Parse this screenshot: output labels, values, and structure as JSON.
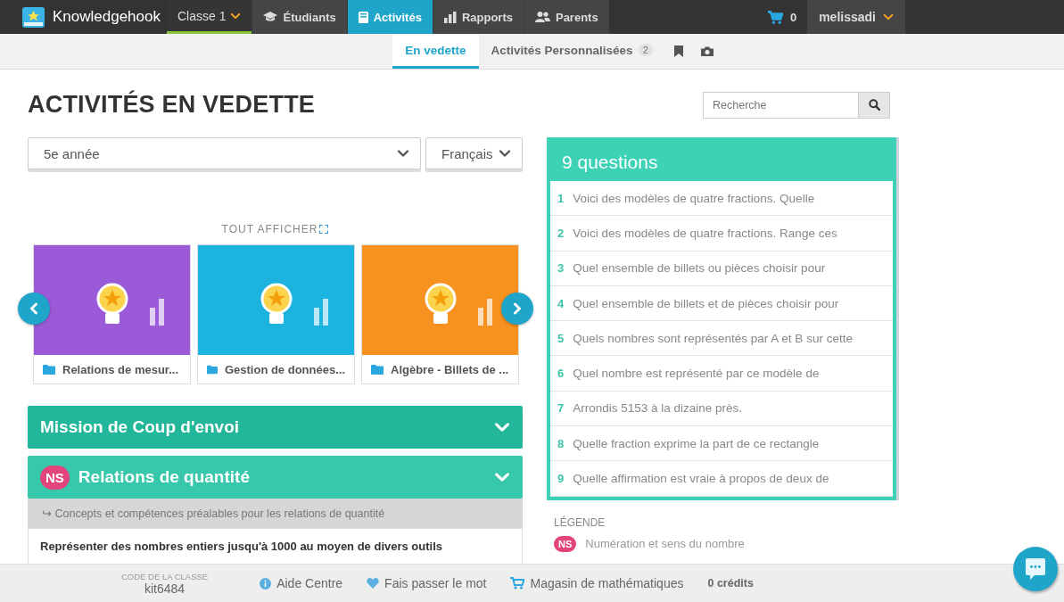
{
  "topbar": {
    "brand": "Knowledgehook",
    "class_selector": {
      "label": "Classe 1"
    },
    "nav": [
      {
        "label": "Étudiants",
        "selected": false
      },
      {
        "label": "Activités",
        "selected": true
      },
      {
        "label": "Rapports",
        "selected": false
      },
      {
        "label": "Parents",
        "selected": false
      }
    ],
    "cart": {
      "count": "0"
    },
    "user": {
      "name": "melissadi"
    }
  },
  "subnav": {
    "tabs": [
      {
        "label": "En vedette",
        "selected": true
      },
      {
        "label": "Activités Personnalisées",
        "badge": "2",
        "selected": false
      }
    ]
  },
  "page_title": "ACTIVITÉS EN VEDETTE",
  "search": {
    "placeholder": "Recherche"
  },
  "filters": {
    "grade": "5e année",
    "language": "Français"
  },
  "carousel": {
    "show_all": "TOUT AFFICHER",
    "cards": [
      {
        "caption": "Relations de mesur...",
        "color": "#9b5bd8"
      },
      {
        "caption": "Gestion de données...",
        "color": "#1cb3df"
      },
      {
        "caption": "Algèbre - Billets de ...",
        "color": "#f7911f"
      }
    ]
  },
  "sections": [
    {
      "title": "Mission de Coup d'envoi",
      "color": "#22b69a"
    },
    {
      "title": "Relations de quantité",
      "color": "#37c8ab",
      "badge": "NS",
      "expanded": true,
      "prerequisite": "↪ Concepts et compétences préalables pour les relations de quantité",
      "outcome": "Représenter des nombres entiers jusqu'à 1000 au moyen de divers outils"
    }
  ],
  "questions": {
    "title": "9 questions",
    "items": [
      {
        "number": "1",
        "text": "Voici des modèles de quatre fractions. Quelle"
      },
      {
        "number": "2",
        "text": "Voici des modèles de quatre fractions. Range ces"
      },
      {
        "number": "3",
        "text": "Quel ensemble de billets ou pièces choisir pour"
      },
      {
        "number": "4",
        "text": "Quel ensemble de billets et de pièces choisir pour"
      },
      {
        "number": "5",
        "text": "Quels nombres sont représentés par A et B sur cette"
      },
      {
        "number": "6",
        "text": "Quel nombre est représenté par ce modèle de"
      },
      {
        "number": "7",
        "text": "Arrondis 5153 à la dizaine près."
      },
      {
        "number": "8",
        "text": "Quelle fraction exprime la part de ce rectangle"
      },
      {
        "number": "9",
        "text": "Quelle affirmation est vraie à propos de deux de"
      }
    ]
  },
  "legend": {
    "title": "LÉGENDE",
    "items": [
      {
        "badge": "NS",
        "label": "Numération et sens du nombre",
        "color": "#e2457c"
      }
    ]
  },
  "footer": {
    "class_code_label": "CODE DE LA CLASSE",
    "class_code": "kit6484",
    "links": [
      {
        "label": "Aide Centre"
      },
      {
        "label": "Fais passer le mot"
      },
      {
        "label": "Magasin de mathématiques"
      }
    ],
    "credits": "0 crédits"
  }
}
